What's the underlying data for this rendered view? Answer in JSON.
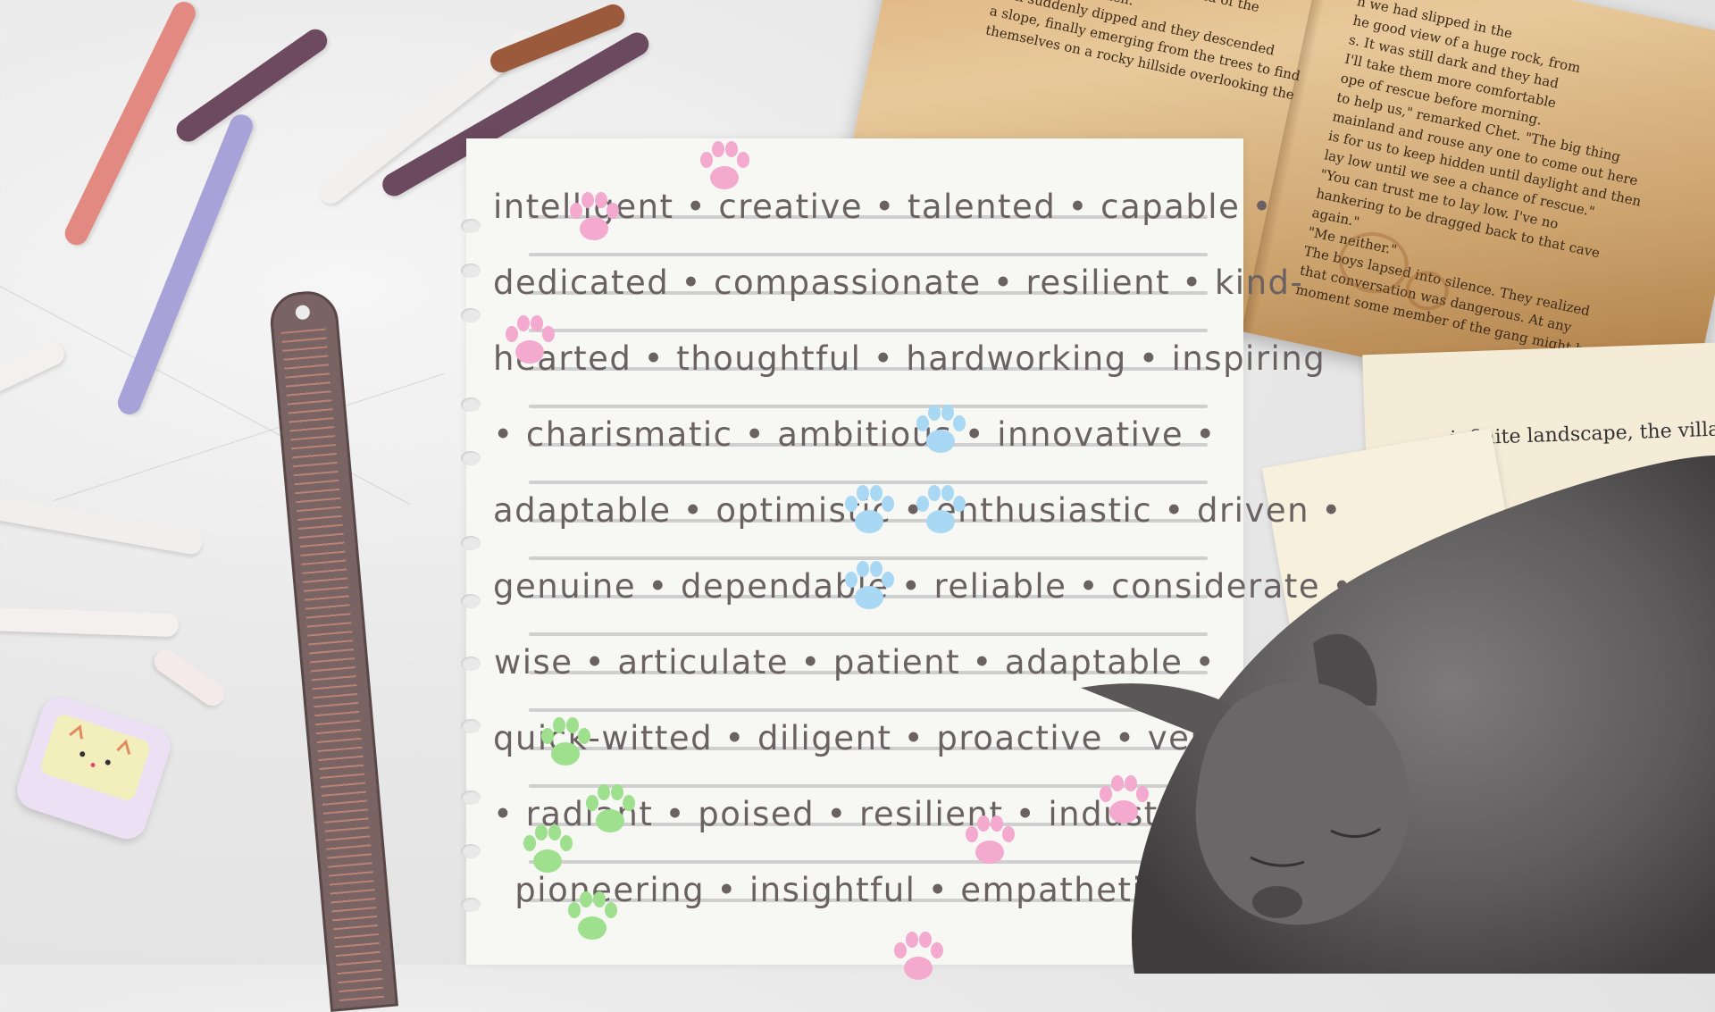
{
  "word_lines": [
    "intelligent • creative • talented • capable •",
    "dedicated • compassionate • resilient • kind-",
    "hearted • thoughtful • hardworking • inspiring",
    "• charismatic • ambitious • innovative •",
    "adaptable • optimistic • enthusiastic • driven •",
    "genuine • dependable • reliable • considerate •",
    "wise • articulate • patient • adaptable •",
    "quick-witted • diligent • proactive • versati",
    "• radiant • poised • resilient • industrious •",
    "pioneering • insightful • empathetic •"
  ],
  "book_text_right": [
    "n we had slipped in the",
    "he good view of a huge rock, from",
    "s. It was still dark and they had",
    "I'll take them more comfortable",
    "ope of rescue before morning.",
    "to help us,\" remarked Chet. \"The big thing",
    "mainland and rouse any one to come out here",
    "is for us to keep hidden until daylight and then",
    "lay low until we see a chance of rescue.\"",
    "\"You can trust me to lay low. I've no",
    "hankering to be dragged back to that cave",
    "again.\"",
    "\"Me neither.\"",
    "The boys lapsed into silence. They realized",
    "that conversation was dangerous. At any",
    "moment some member of the gang might be"
  ],
  "book_text_left": [
    "closer and they heard the sound of the",
    "nearer to the beach.",
    "path suddenly dipped and they descended",
    "a slope, finally emerging from the trees to find",
    "themselves on a rocky hillside overlooking the"
  ],
  "sheet_text": "infinite landscape, the village s",
  "colors": {
    "paw_pink": "#f4a9cf",
    "paw_blue": "#a9d8f4",
    "paw_green": "#9ee08e",
    "text": "#6a6262"
  }
}
